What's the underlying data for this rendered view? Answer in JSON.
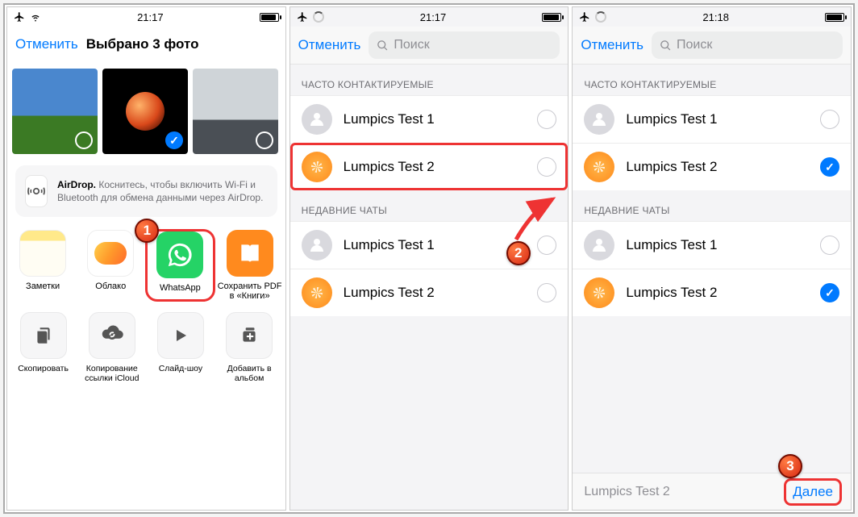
{
  "screens": {
    "s1": {
      "time": "21:17",
      "cancel": "Отменить",
      "title": "Выбрано 3 фото",
      "airdrop_title": "AirDrop.",
      "airdrop_text": "Коснитесь, чтобы включить Wi-Fi и Bluetooth для обмена данными через AirDrop.",
      "apps": {
        "notes": "Заметки",
        "cloud": "Облако",
        "whatsapp": "WhatsApp",
        "books": "Сохранить PDF в «Книги»"
      },
      "actions": {
        "copy": "Скопировать",
        "icloud": "Копирование ссылки iCloud",
        "slideshow": "Слайд-шоу",
        "add": "Добавить в альбом"
      }
    },
    "s2": {
      "time": "21:17",
      "cancel": "Отменить",
      "search_placeholder": "Поиск",
      "section_freq": "ЧАСТО КОНТАКТИРУЕМЫЕ",
      "section_recent": "НЕДАВНИЕ ЧАТЫ",
      "contacts": {
        "c1": "Lumpics Test 1",
        "c2": "Lumpics Test 2"
      }
    },
    "s3": {
      "time": "21:18",
      "cancel": "Отменить",
      "search_placeholder": "Поиск",
      "section_freq": "ЧАСТО КОНТАКТИРУЕМЫЕ",
      "section_recent": "НЕДАВНИЕ ЧАТЫ",
      "contacts": {
        "c1": "Lumpics Test 1",
        "c2": "Lumpics Test 2"
      },
      "selected_name": "Lumpics Test 2",
      "next": "Далее"
    }
  },
  "badges": {
    "b1": "1",
    "b2": "2",
    "b3": "3"
  }
}
